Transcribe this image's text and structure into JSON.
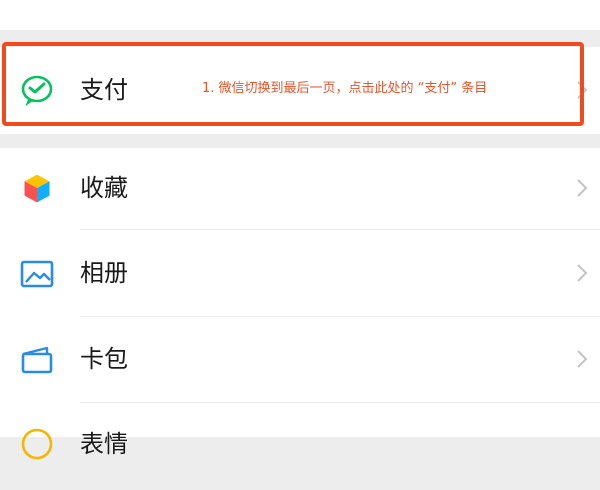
{
  "menu": {
    "pay": {
      "label": "支付",
      "icon": "wechat-pay-icon"
    },
    "items": [
      {
        "label": "收藏",
        "icon": "favorites-cube-icon"
      },
      {
        "label": "相册",
        "icon": "album-photo-icon"
      },
      {
        "label": "卡包",
        "icon": "card-wallet-icon"
      },
      {
        "label": "表情",
        "icon": "sticker-smile-icon"
      }
    ]
  },
  "annotation": {
    "text": "1. 微信切换到最后一页，点击此处的 “支付” 条目",
    "color": "#f04a1e"
  },
  "colors": {
    "background": "#ededed",
    "row": "#ffffff",
    "accent_green": "#07c160"
  }
}
